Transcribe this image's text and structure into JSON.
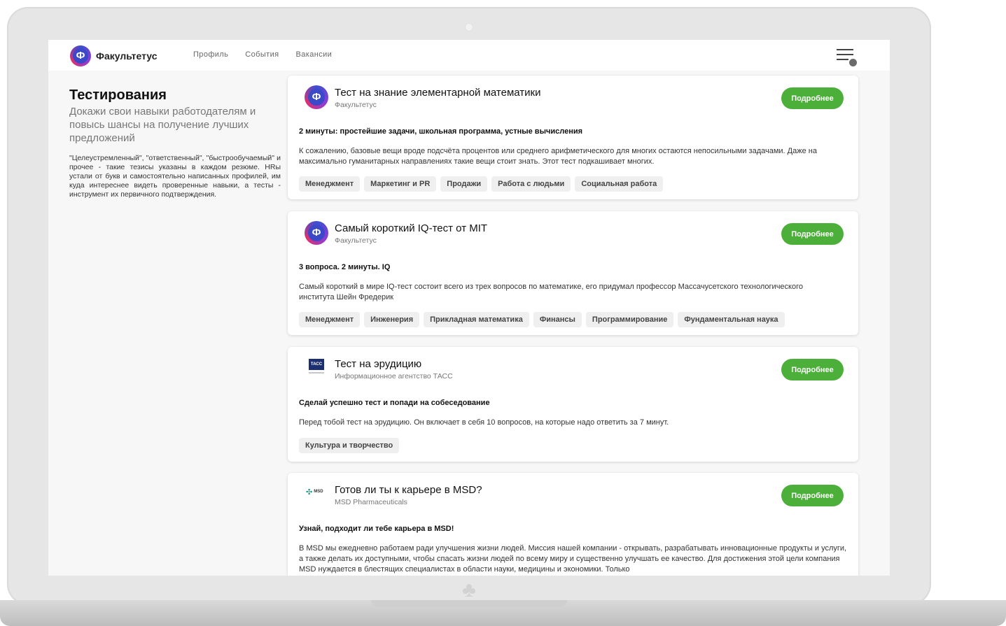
{
  "app": {
    "name": "Факультетус",
    "logo_letter": "Ф"
  },
  "nav": {
    "items": [
      "Профиль",
      "События",
      "Вакансии"
    ]
  },
  "intro": {
    "title": "Тестирования",
    "subtitle": "Докажи свои навыки работодателям и повысь шансы на получение лучших предложений",
    "description": "\"Целеустремленный\", \"ответственный\", \"быстрообучаемый\" и прочее - такие тезисы указаны в каждом резюме. HRы устали от букв и самостоятельно написанных профилей, им куда интереснее видеть проверенные навыки, а тесты - инструмент их первичного подтверждения."
  },
  "cards": [
    {
      "title": "Тест на знание элементарной математики",
      "company": "Факультетус",
      "button": "Подробнее",
      "headline": "2 минуты: простейшие задачи, школьная программа, устные вычисления",
      "description": "К сожалению, базовые вещи вроде подсчёта процентов или среднего арифметического для многих остаются непосильными задачами. Даже на максимально гуманитарных направлениях такие вещи стоит знать. Этот тест подкашивает многих.",
      "tags": [
        "Менеджмент",
        "Маркетинг и PR",
        "Продажи",
        "Работа с людьми",
        "Социальная работа"
      ]
    },
    {
      "title": "Самый короткий IQ-тест от MIT",
      "company": "Факультетус",
      "button": "Подробнее",
      "headline": "3 вопроса. 2 минуты. IQ",
      "description": "Самый короткий в мире IQ-тест состоит всего из трех вопросов по математике, его придумал профессор Массачусетского технологического института Шейн Фредерик",
      "tags": [
        "Менеджмент",
        "Инженерия",
        "Прикладная математика",
        "Финансы",
        "Программирование",
        "Фундаментальная наука"
      ]
    },
    {
      "title": "Тест на эрудицию",
      "company": "Информационное агентство ТАСС",
      "logo_text": "ТАСС",
      "button": "Подробнее",
      "headline": "Сделай успешно тест и попади на собеседование",
      "description": "Перед тобой тест на эрудицию. Он включает в себя 10 вопросов, на которые надо ответить за 7 минут.",
      "tags": [
        "Культура и творчество"
      ]
    },
    {
      "title": "Готов ли ты к карьере в MSD?",
      "company": "MSD Pharmaceuticals",
      "logo_text": "MSD",
      "button": "Подробнее",
      "headline": "Узнай, подходит ли тебе карьера в MSD!",
      "description": "В MSD мы ежедневно работаем ради улучшения жизни людей. Миссия нашей компании - открывать, разрабатывать инновационные продукты и услуги, а также делать их доступными, чтобы спасать жизни людей по всему миру и существенно улучшать ее качество. Для достижения этой цели компания MSD нуждается в блестящих специалистах в области науки, медицины и экономики. Только",
      "tags": []
    }
  ],
  "colors": {
    "accent_green": "#4caf3a",
    "brand_blue": "#3b49c9",
    "frame_gray": "#e6e6e6"
  }
}
